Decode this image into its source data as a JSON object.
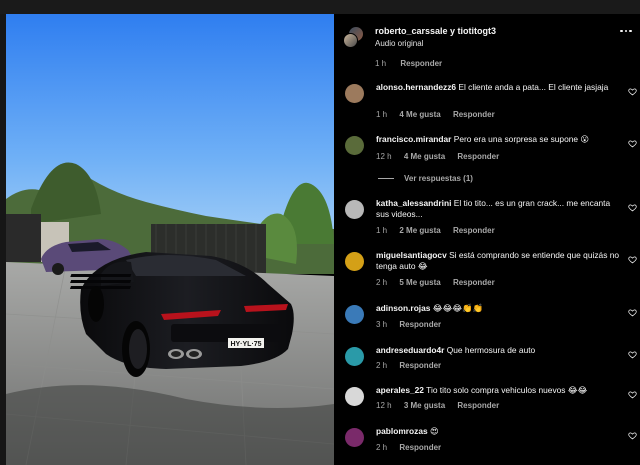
{
  "post": {
    "authors": "roberto_carssale y tiotitogt3",
    "audio": "Audio original",
    "time": "1 h",
    "reply_label": "Responder"
  },
  "comments": [
    {
      "user": "alonso.hernandezz6",
      "text": "El cliente anda a pata... El cliente jasjaja",
      "time": "1 h",
      "likes": "4 Me gusta",
      "reply": "Responder",
      "avatar_color": "#9c7a5d"
    },
    {
      "user": "francisco.mirandar",
      "text": "Pero era una sorpresa se supone 😮",
      "time": "12 h",
      "likes": "4 Me gusta",
      "reply": "Responder",
      "avatar_color": "#5a6b3a"
    },
    {
      "user": "katha_alessandrini",
      "text": "El tio tito... es un gran crack... me encanta sus videos...",
      "time": "1 h",
      "likes": "2 Me gusta",
      "reply": "Responder",
      "avatar_color": "#b8b8b8"
    },
    {
      "user": "miguelsantiagocv",
      "text": "Si está comprando se entiende que quizás no tenga auto 😂",
      "time": "2 h",
      "likes": "5 Me gusta",
      "reply": "Responder",
      "avatar_color": "#d4a017"
    },
    {
      "user": "adinson.rojas",
      "text": "😂😂😂👏👏",
      "time": "3 h",
      "likes": "",
      "reply": "Responder",
      "avatar_color": "#3a7ab8"
    },
    {
      "user": "andreseduardo4r",
      "text": "Que hermosura de auto",
      "time": "2 h",
      "likes": "",
      "reply": "Responder",
      "avatar_color": "#2a9aa8"
    },
    {
      "user": "aperales_22",
      "text": "Tio tito solo compra vehiculos nuevos 😂😂",
      "time": "12 h",
      "likes": "3 Me gusta",
      "reply": "Responder",
      "avatar_color": "#d8d8d8"
    },
    {
      "user": "pablomrozas",
      "text": "😍",
      "time": "2 h",
      "likes": "",
      "reply": "Responder",
      "avatar_color": "#7a2a6a"
    }
  ],
  "view_replies": "Ver respuestas (1)",
  "car": {
    "plate": "HY·YL·75"
  },
  "colors": {
    "background": "#000000",
    "text_primary": "#f5f5f5",
    "text_secondary": "#a8a8a8"
  }
}
